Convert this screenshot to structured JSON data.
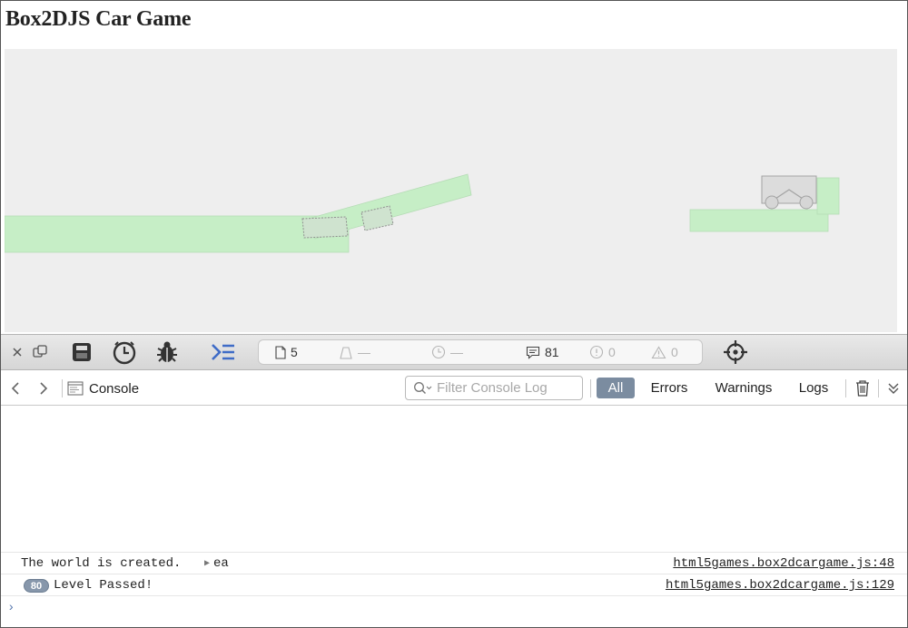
{
  "page": {
    "title": "Box2DJS Car Game"
  },
  "game": {
    "background_color": "#eeeeee",
    "ground_color": "#c6eec6",
    "body_outline_color": "#999999",
    "car_color": "#dcdcdc"
  },
  "toolbar": {
    "icons": [
      "close-icon",
      "undock-icon",
      "storage-icon",
      "timelines-icon",
      "debugger-icon",
      "console-icon",
      "inspect-target-icon"
    ],
    "status": {
      "resources_count": "5",
      "load_size": "—",
      "load_time": "—",
      "logs_count": "81",
      "errors_count": "0",
      "warnings_count": "0"
    }
  },
  "console_bar": {
    "tab_label": "Console",
    "filter_placeholder": "Filter Console Log",
    "scopes": [
      {
        "label": "All",
        "active": true
      },
      {
        "label": "Errors",
        "active": false
      },
      {
        "label": "Warnings",
        "active": false
      },
      {
        "label": "Logs",
        "active": false
      }
    ],
    "accent_color": "#7b8ca0"
  },
  "console_log": {
    "messages": [
      {
        "text": "The world is created.",
        "object_label": "ea",
        "source": "html5games.box2dcargame.js:48"
      },
      {
        "text": "Level Passed!",
        "repeat_count": "80",
        "source": "html5games.box2dcargame.js:129"
      }
    ],
    "prompt_symbol": "›"
  }
}
